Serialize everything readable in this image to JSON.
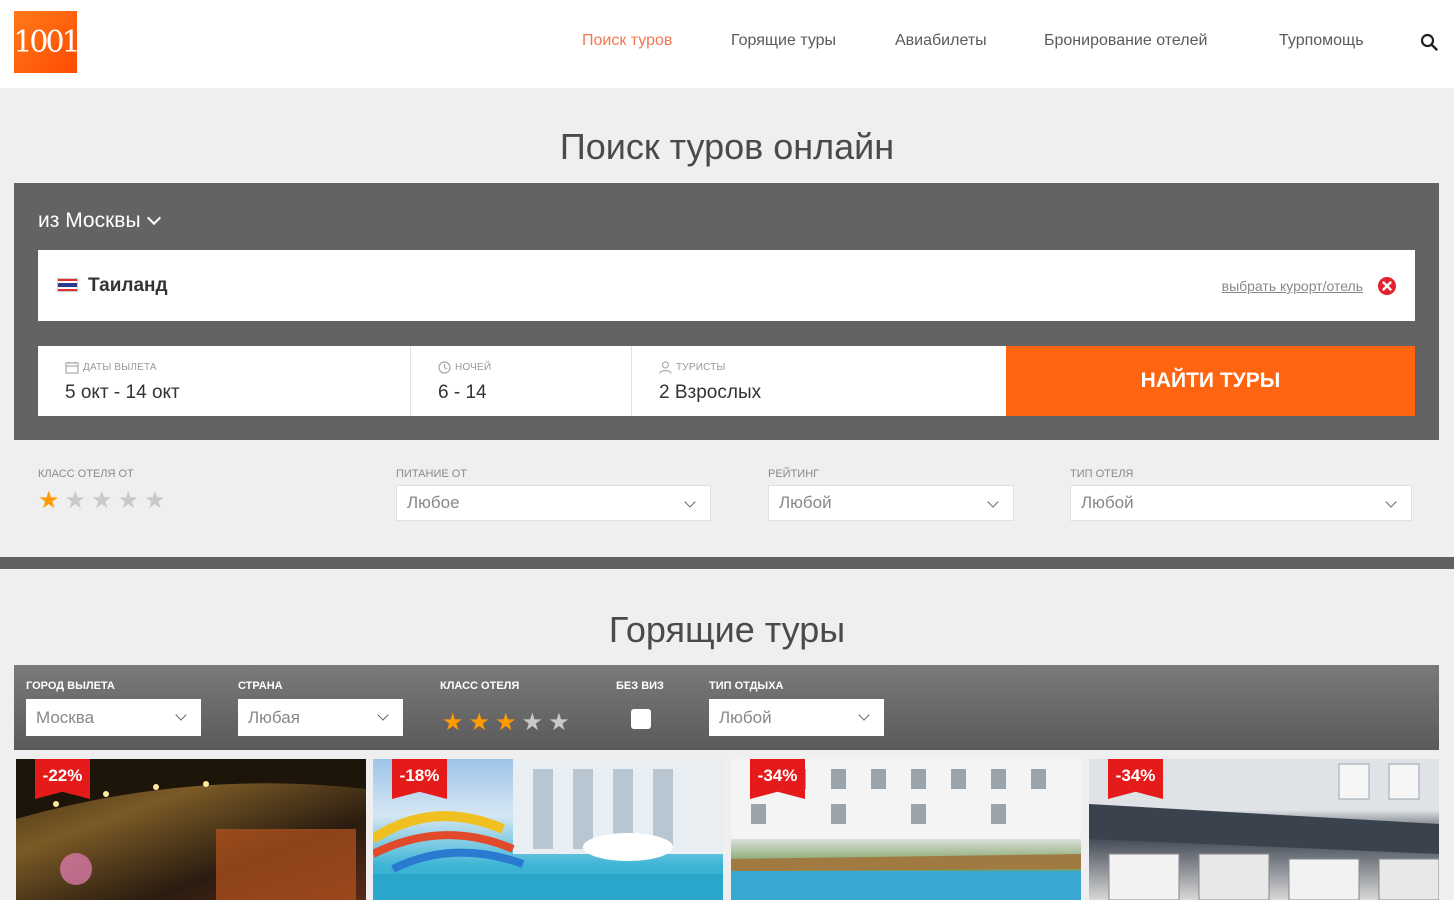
{
  "header": {
    "logo_text": "1001",
    "nav": [
      {
        "label": "Поиск туров",
        "active": true
      },
      {
        "label": "Горящие туры",
        "active": false
      },
      {
        "label": "Авиабилеты",
        "active": false
      },
      {
        "label": "Бронирование отелей",
        "active": false
      },
      {
        "label": "Турпомощь",
        "active": false
      }
    ],
    "search_icon": "search-icon"
  },
  "search": {
    "title": "Поиск туров онлайн",
    "from_city": "из Москвы",
    "destination": "Таиланд",
    "destination_flag": "thailand-flag",
    "choose_link": "выбрать курорт/отель",
    "dates": {
      "label": "Даты вылета",
      "value": "5 окт - 14 окт"
    },
    "nights": {
      "label": "Ночей",
      "value": "6 - 14"
    },
    "tourists": {
      "label": "Туристы",
      "value": "2 Взрослых"
    },
    "find_button": "НАЙТИ ТУРЫ"
  },
  "filters": {
    "hotel_class": {
      "label": "Класс отеля от",
      "stars_selected": 1,
      "stars_total": 5
    },
    "meal": {
      "label": "Питание от",
      "value": "Любое"
    },
    "rating": {
      "label": "Рейтинг",
      "value": "Любой"
    },
    "hotel_type": {
      "label": "Тип отеля",
      "value": "Любой"
    }
  },
  "hot_tours": {
    "title": "Горящие туры",
    "departure_city": {
      "label": "Город вылета",
      "value": "Москва"
    },
    "country": {
      "label": "Страна",
      "value": "Любая"
    },
    "hotel_class": {
      "label": "Класс отеля",
      "stars_selected": 3,
      "stars_total": 5
    },
    "no_visa": {
      "label": "Без виз",
      "checked": false
    },
    "rest_type": {
      "label": "Тип отдыха",
      "value": "Любой"
    },
    "cards": [
      {
        "discount": "-22%"
      },
      {
        "discount": "-18%"
      },
      {
        "discount": "-34%"
      },
      {
        "discount": "-34%"
      }
    ]
  },
  "colors": {
    "accent": "#ff6410",
    "nav_active": "#f07850",
    "panel": "#636363",
    "badge": "#e51b1b",
    "star_on": "#ff9b00"
  }
}
